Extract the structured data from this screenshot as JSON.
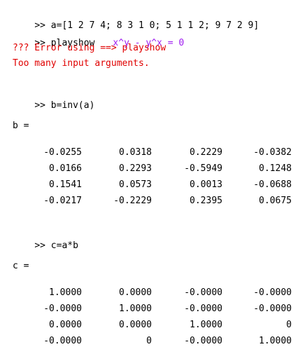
{
  "console": {
    "lines": [
      {
        "prompt": ">>",
        "command": " a=[1 2 7 4; 8 3 1 0; 5 1 1 2; 9 7 2 9]"
      },
      {
        "prompt": ">>",
        "command": " playshow",
        "string_arg": "x^y - y^x = 0"
      },
      {
        "error": "??? Error using ==> playshow"
      },
      {
        "error": "Too many input arguments."
      },
      {
        "prompt": ">>",
        "command": " b=inv(a)"
      },
      {
        "output_label": "b ="
      },
      {
        "prompt": ">>",
        "command": " c=a*b"
      },
      {
        "output_label": "c ="
      }
    ],
    "matrix_b": [
      [
        "-0.0255",
        "0.0318",
        "0.2229",
        "-0.0382"
      ],
      [
        "0.0166",
        "0.2293",
        "-0.5949",
        "0.1248"
      ],
      [
        "0.1541",
        "0.0573",
        "0.0013",
        "-0.0688"
      ],
      [
        "-0.0217",
        "-0.2229",
        "0.2395",
        "0.0675"
      ]
    ],
    "matrix_c": [
      [
        "1.0000",
        "0.0000",
        "-0.0000",
        "-0.0000"
      ],
      [
        "-0.0000",
        "1.0000",
        "-0.0000",
        "-0.0000"
      ],
      [
        "0.0000",
        "0.0000",
        "1.0000",
        "0"
      ],
      [
        "-0.0000",
        "0",
        "-0.0000",
        "1.0000"
      ]
    ],
    "colors": {
      "error": "#e00000",
      "string": "#a020f0",
      "text": "#000000"
    }
  }
}
